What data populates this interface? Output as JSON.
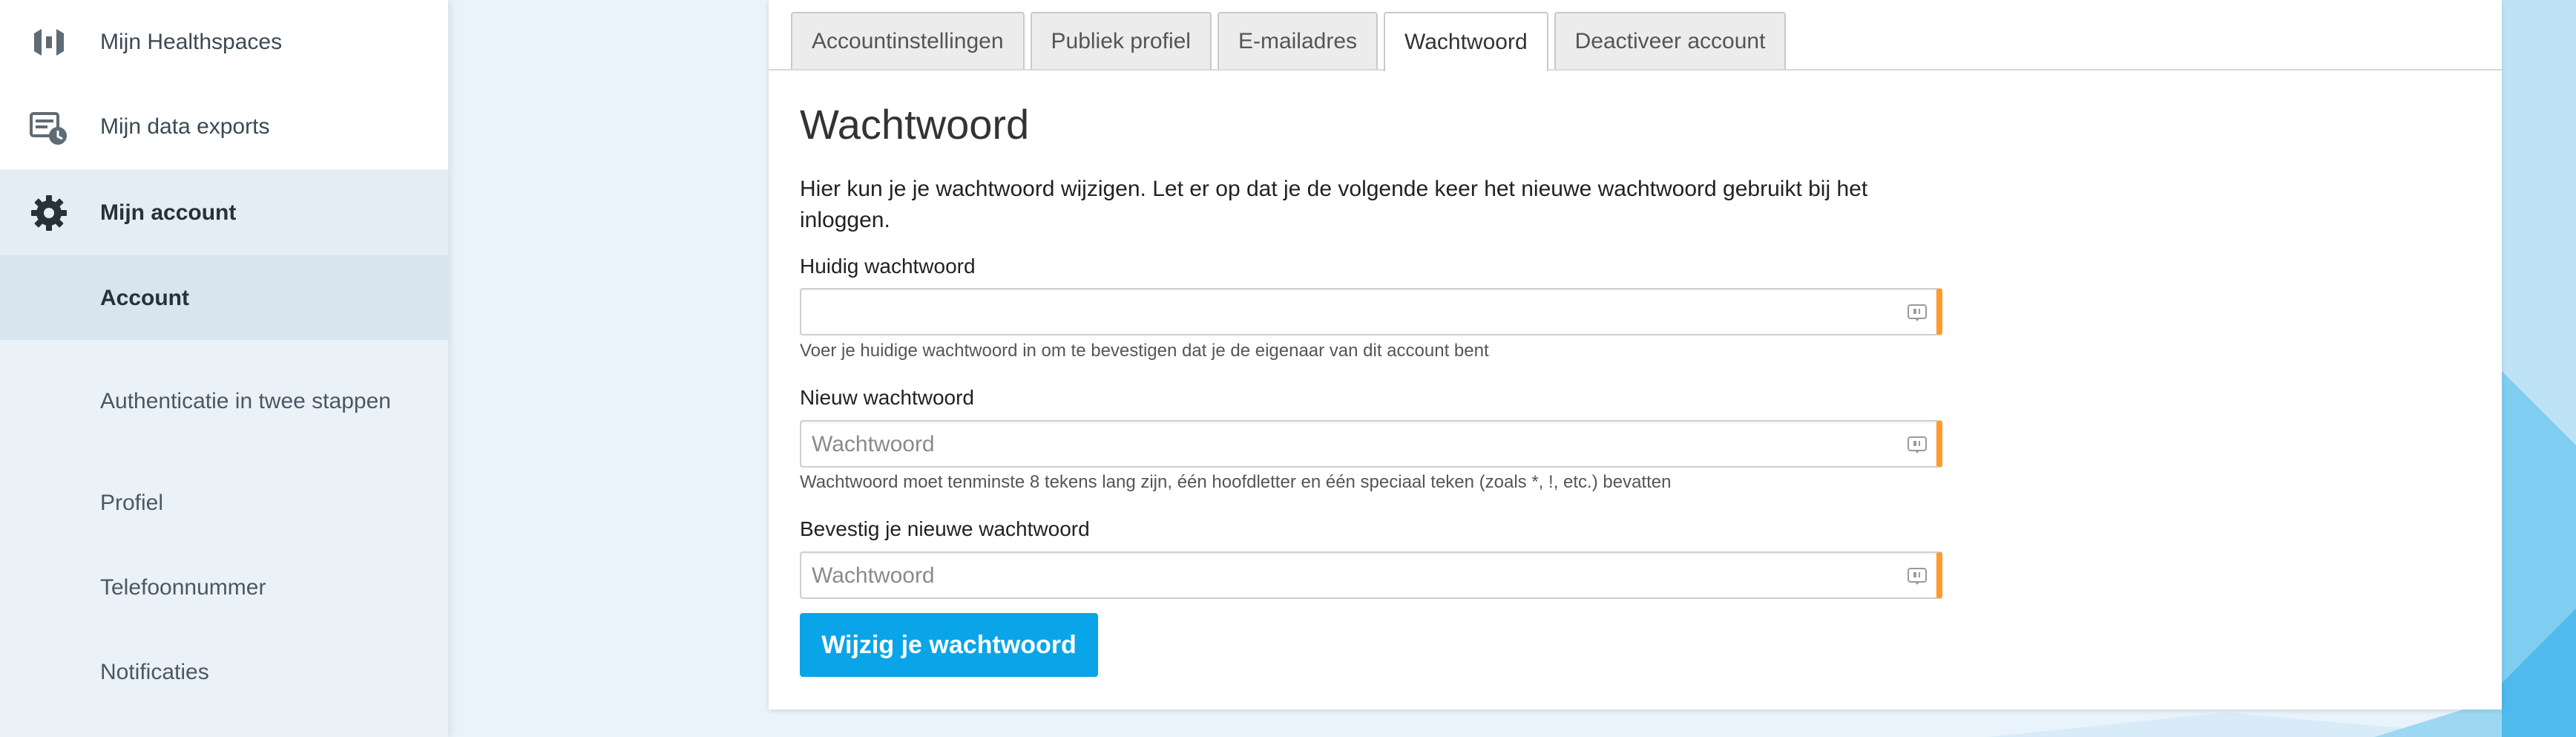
{
  "sidebar": {
    "items": [
      {
        "label": "Mijn Healthspaces",
        "icon": "healthspaces-logo-icon"
      },
      {
        "label": "Mijn data exports",
        "icon": "data-export-icon"
      },
      {
        "label": "Mijn account",
        "icon": "gear-icon"
      }
    ],
    "subitems": [
      {
        "label": "Account"
      },
      {
        "label": "Authenticatie in twee stappen"
      },
      {
        "label": "Profiel"
      },
      {
        "label": "Telefoonnummer"
      },
      {
        "label": "Notificaties"
      }
    ]
  },
  "tabs": [
    {
      "label": "Accountinstellingen"
    },
    {
      "label": "Publiek profiel"
    },
    {
      "label": "E-mailadres"
    },
    {
      "label": "Wachtwoord",
      "active": true
    },
    {
      "label": "Deactiveer account"
    }
  ],
  "main": {
    "title": "Wachtwoord",
    "intro": "Hier kun je je wachtwoord wijzigen. Let er op dat je de volgende keer het nieuwe wachtwoord gebruikt bij het inloggen.",
    "current_password": {
      "label": "Huidig wachtwoord",
      "value": "",
      "placeholder": "",
      "help": "Voer je huidige wachtwoord in om te bevestigen dat je de eigenaar van dit account bent"
    },
    "new_password": {
      "label": "Nieuw wachtwoord",
      "value": "",
      "placeholder": "Wachtwoord",
      "help": "Wachtwoord moet tenminste 8 tekens lang zijn, één hoofdletter en één speciaal teken (zoals *, !, etc.) bevatten"
    },
    "confirm_password": {
      "label": "Bevestig je nieuwe wachtwoord",
      "value": "",
      "placeholder": "Wachtwoord"
    },
    "submit_label": "Wijzig je wachtwoord"
  },
  "colors": {
    "accent": "#0aa5e8",
    "field_marker": "#ff9a2e",
    "sidebar_bg": "#eaf1f7",
    "page_bg": "#e8f3fb"
  }
}
